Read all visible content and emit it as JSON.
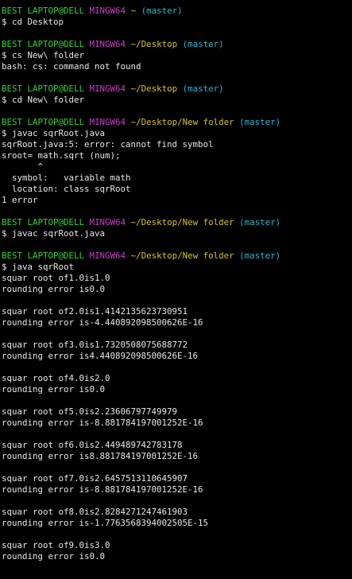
{
  "colors": {
    "background": "#000000",
    "user": "#35d23a",
    "host": "#c93ec9",
    "path": "#d6c22e",
    "branch": "#2fb8cf",
    "text": "#e8e8e8"
  },
  "blocks": [
    {
      "user": "BEST LAPTOP@DELL",
      "host": "MINGW64",
      "path": "~",
      "branch": "(master)",
      "command": "$ cd Desktop",
      "output": []
    },
    {
      "user": "BEST LAPTOP@DELL",
      "host": "MINGW64",
      "path": "~/Desktop",
      "branch": "(master)",
      "command": "$ cs New\\ folder",
      "output": [
        "bash: cs: command not found"
      ]
    },
    {
      "user": "BEST LAPTOP@DELL",
      "host": "MINGW64",
      "path": "~/Desktop",
      "branch": "(master)",
      "command": "$ cd New\\ folder",
      "output": []
    },
    {
      "user": "BEST LAPTOP@DELL",
      "host": "MINGW64",
      "path": "~/Desktop/New folder",
      "branch": "(master)",
      "command": "$ javac sqrRoot.java",
      "output": [
        "sqrRoot.java:5: error: cannot find symbol",
        "sroot= math.sqrt (num);",
        "       ^",
        "  symbol:   variable math",
        "  location: class sqrRoot",
        "1 error"
      ]
    },
    {
      "user": "BEST LAPTOP@DELL",
      "host": "MINGW64",
      "path": "~/Desktop/New folder",
      "branch": "(master)",
      "command": "$ javac sqrRoot.java",
      "output": []
    },
    {
      "user": "BEST LAPTOP@DELL",
      "host": "MINGW64",
      "path": "~/Desktop/New folder",
      "branch": "(master)",
      "command": "$ java sqrRoot",
      "output": [
        "squar root of1.0is1.0",
        "rounding error is0.0",
        "",
        "squar root of2.0is1.4142135623730951",
        "rounding error is-4.440892098500626E-16",
        "",
        "squar root of3.0is1.7320508075688772",
        "rounding error is4.440892098500626E-16",
        "",
        "squar root of4.0is2.0",
        "rounding error is0.0",
        "",
        "squar root of5.0is2.23606797749979",
        "rounding error is-8.881784197001252E-16",
        "",
        "squar root of6.0is2.449489742783178",
        "rounding error is8.881784197001252E-16",
        "",
        "squar root of7.0is2.6457513110645907",
        "rounding error is-8.881784197001252E-16",
        "",
        "squar root of8.0is2.8284271247461903",
        "rounding error is-1.7763568394002505E-15",
        "",
        "squar root of9.0is3.0",
        "rounding error is0.0"
      ]
    }
  ]
}
